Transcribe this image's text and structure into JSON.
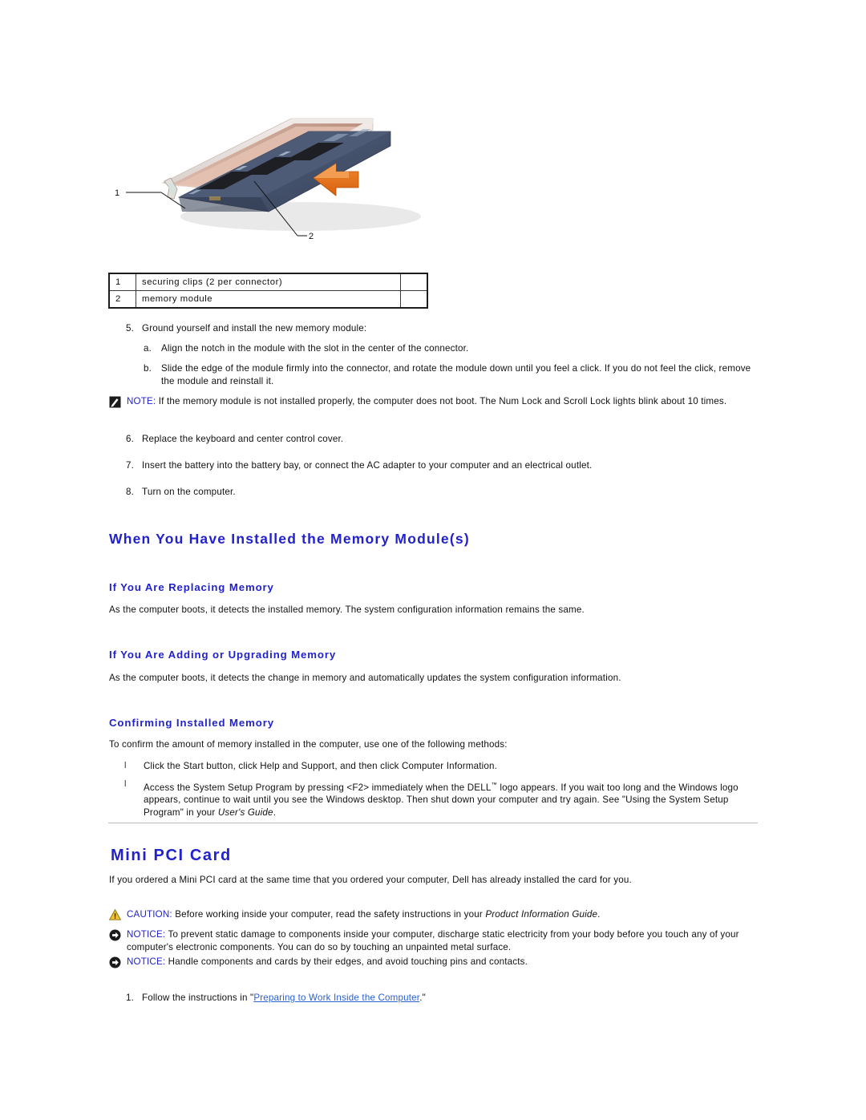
{
  "figure": {
    "alt_description": "Memory module being pressed into the SODIMM connector, orange arrow indicating downward pressure",
    "callout_1_label": "1",
    "callout_2_label": "2"
  },
  "callout_table": {
    "rows": [
      {
        "num": "1",
        "desc": "securing clips (2 per connector)",
        "blank": ""
      },
      {
        "num": "2",
        "desc": "memory module",
        "blank": ""
      }
    ]
  },
  "steps_memory": [
    {
      "marker": "5.",
      "text": "Ground yourself and install the new memory module:"
    },
    {
      "marker": "6.",
      "text": "Replace the keyboard and center control cover."
    },
    {
      "marker": "7.",
      "text": "Insert the battery into the battery bay, or connect the AC adapter to your computer and an electrical outlet."
    },
    {
      "marker": "8.",
      "text": "Turn on the computer."
    }
  ],
  "substeps_memory": [
    {
      "marker": "a.",
      "text": "Align the notch in the module with the slot in the center of the connector."
    },
    {
      "marker": "b.",
      "text": "Slide the edge of the module firmly into the connector, and rotate the module down until you feel a click. If you do not feel the click, remove the module and reinstall it."
    }
  ],
  "note_memory": {
    "icon": "note-pencil-icon",
    "label": "NOTE:",
    "text": "If the memory module is not installed properly, the computer does not boot. The Num Lock and Scroll Lock lights blink about 10 times."
  },
  "section_installed": {
    "heading": "When You Have Installed the Memory Module(s)",
    "sub_replacing": {
      "heading": "If You Are Replacing Memory",
      "text": "As the computer boots, it detects the installed memory. The system configuration information remains the same."
    },
    "sub_adding": {
      "heading": "If You Are Adding or Upgrading Memory",
      "text": "As the computer boots, it detects the change in memory and automatically updates the system configuration information."
    },
    "sub_confirming": {
      "heading": "Confirming Installed Memory",
      "intro": "To confirm the amount of memory installed in the computer, use one of the following methods:",
      "bullets": [
        {
          "marker": "l",
          "text": "Click the Start button, click Help and Support, and then click Computer Information."
        },
        {
          "marker": "l",
          "text_part1": "Access the System Setup Program by pressing <F2> immediately when the DELL",
          "trademark": "™",
          "text_part2": " logo appears. If you wait too long and the Windows logo appears, continue to wait until you see the Windows desktop. Then shut down your computer and try again. See \"Using the System Setup Program\" in your ",
          "italic_tail": "User's Guide",
          "text_part3": "."
        }
      ]
    }
  },
  "section_minipci": {
    "heading": "Mini PCI Card",
    "intro": "If you ordered a Mini PCI card at the same time that you ordered your computer, Dell has already installed the card for you.",
    "caution": {
      "icon": "caution-triangle-icon",
      "label": "CAUTION:",
      "text_before": " Before working inside your computer, read the safety instructions in your ",
      "italic": "Product Information Guide",
      "text_after": "."
    },
    "notice_1": {
      "icon": "notice-arrow-icon",
      "label": "NOTICE:",
      "text": " To prevent static damage to components inside your computer, discharge static electricity from your body before you touch any of your computer's electronic components. You can do so by touching an unpainted metal surface."
    },
    "notice_2": {
      "icon": "notice-arrow-icon",
      "label": "NOTICE:",
      "text": " Handle components and cards by their edges, and avoid touching pins and contacts."
    },
    "step_1": {
      "marker": "1.",
      "text_before": "Follow the instructions in \"",
      "link_text": "Preparing to Work Inside the Computer",
      "text_after": ".\""
    }
  },
  "colors": {
    "heading_blue": "#2222CC",
    "link_blue": "#2A5FD0",
    "caution_yellow": "#F2C230",
    "arrow_orange": "#E8701A",
    "rule_gray": "#B9B9B9"
  }
}
